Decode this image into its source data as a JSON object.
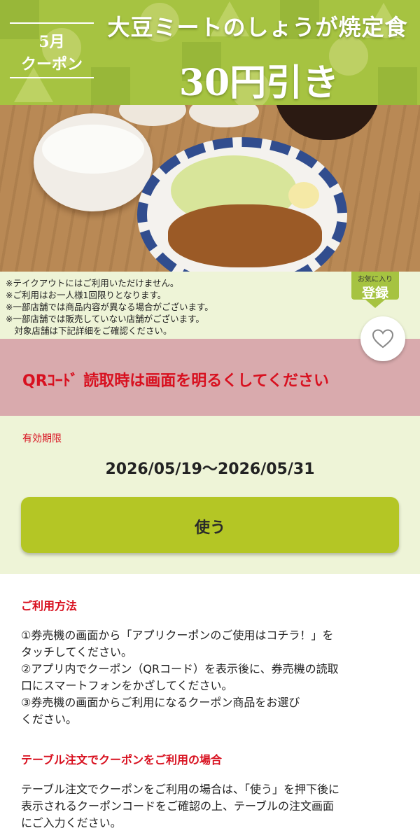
{
  "banner": {
    "month": "5月",
    "coupon_label": "クーポン",
    "title": "大豆ミートのしょうが焼定食",
    "discount": "30円引き",
    "colors": {
      "background": "#a6c341",
      "text": "#ffffff"
    }
  },
  "notes": [
    "※テイクアウトにはご利用いただけません。",
    "※ご利用はお一人様1回限りとなります。",
    "※一部店舗では商品内容が異なる場合がございます。",
    "※一部店舗では販売していない店舗がございます。",
    "　対象店舗は下記詳細をご確認ください。"
  ],
  "favorite": {
    "badge_small": "お気に入り",
    "badge_big": "登録",
    "icon": "heart-icon"
  },
  "qr_warning": "QRｺｰﾄﾞ 読取時は画面を明るくしてください",
  "validity": {
    "label": "有効期限",
    "dates": "2026/05/19～2026/05/31"
  },
  "use_button": "使う",
  "usage": {
    "title": "ご利用方法",
    "lines": [
      "①券売機の画面から「アプリクーポンのご使用はコチラ！」を",
      "タッチしてください。",
      "②アプリ内でクーポン（QRコード）を表示後に、券売機の読取",
      "口にスマートフォンをかざしてください。",
      "③券売機の画面からご利用になるクーポン商品をお選び",
      "ください。"
    ]
  },
  "table_order": {
    "title": "テーブル注文でクーポンをご利用の場合",
    "lines": [
      "テーブル注文でクーポンをご利用の場合は、「使う」を押下後に",
      "表示されるクーポンコードをご確認の上、テーブルの注文画面",
      "にご入力ください。"
    ]
  },
  "colors": {
    "accent_red": "#d8101f",
    "light_green_bg": "#eef4d7",
    "warning_bg": "#d9aaad",
    "button_green": "#b4c625"
  }
}
